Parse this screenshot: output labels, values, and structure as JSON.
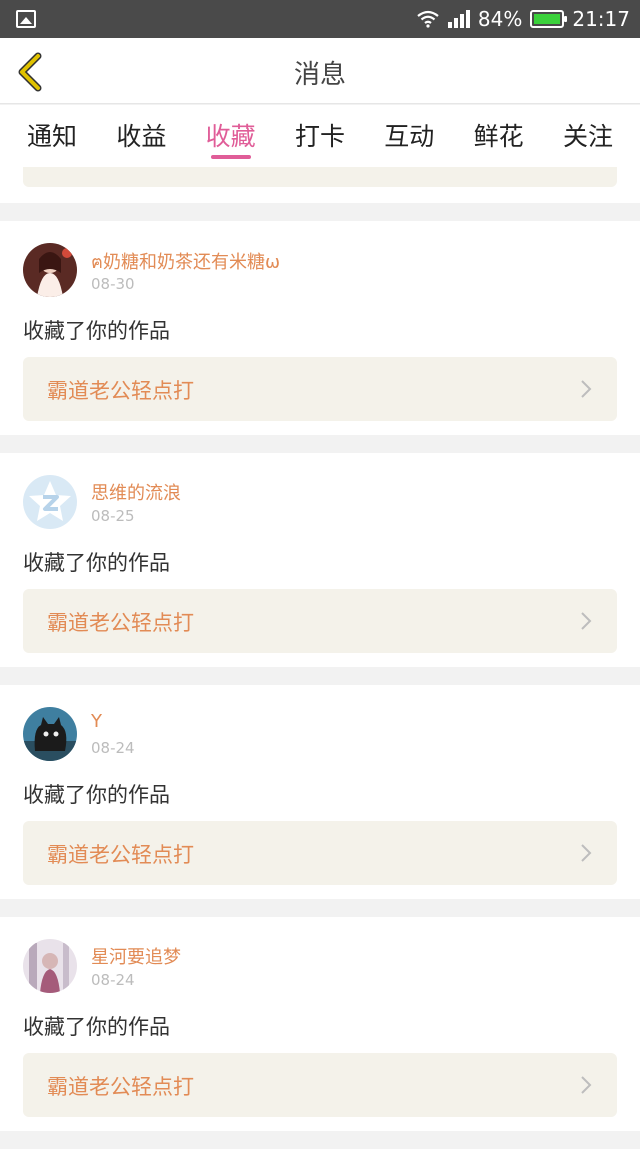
{
  "status_bar": {
    "battery": "84%",
    "time": "21:17"
  },
  "nav": {
    "title": "消息"
  },
  "tabs": [
    {
      "label": "通知"
    },
    {
      "label": "收益"
    },
    {
      "label": "收藏",
      "active": true
    },
    {
      "label": "打卡"
    },
    {
      "label": "互动"
    },
    {
      "label": "鲜花"
    },
    {
      "label": "关注"
    }
  ],
  "items": [
    {
      "user": "ฅ奶糖和奶茶还有米糖ω",
      "date": "08-30",
      "action": "收藏了你的作品",
      "work": "霸道老公轻点打",
      "avatar_icon": "girl-photo-avatar"
    },
    {
      "user": "思维的流浪",
      "date": "08-25",
      "action": "收藏了你的作品",
      "work": "霸道老公轻点打",
      "avatar_icon": "qzone-default-avatar"
    },
    {
      "user": "Y",
      "date": "08-24",
      "action": "收藏了你的作品",
      "work": "霸道老公轻点打",
      "avatar_icon": "cat-avatar"
    },
    {
      "user": "星河要追梦",
      "date": "08-24",
      "action": "收藏了你的作品",
      "work": "霸道老公轻点打",
      "avatar_icon": "girl-photo-avatar"
    }
  ],
  "colors": {
    "accent": "#e05d98",
    "username": "#e28b55",
    "back_icon": "#d4b800"
  }
}
